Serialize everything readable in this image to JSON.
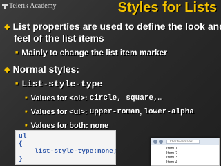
{
  "header": {
    "logo_text": "Telerik Academy",
    "title": "Styles for Lists"
  },
  "bullets": {
    "b1_line1": "List properties are used to define the look and",
    "b1_line2": "feel of the list items",
    "b1_sub": "Mainly to change the list item marker",
    "b2": "Normal styles:",
    "b2_sub": "List-style-type",
    "b2_sub_a_prefix": "Values for <ol>: ",
    "b2_sub_a_code": "circle, square,…",
    "b2_sub_b_prefix": "Values for <ul>: ",
    "b2_sub_b_code1": "upper-roman",
    "b2_sub_b_sep": ", ",
    "b2_sub_b_code2": "lower-alpha",
    "b2_sub_c": "Values for both: none"
  },
  "code": {
    "line1": "ul",
    "line2": "{",
    "line3": "    list-style-type:none;",
    "line4": "}"
  },
  "browser_shot": {
    "address": "Other bookmarks",
    "items": [
      "Item 1",
      "Item 2",
      "Item 3",
      "Item 4"
    ]
  },
  "colors": {
    "accent": "#f2c100",
    "code_text": "#2f57a8",
    "background": "#2b2b2b"
  }
}
